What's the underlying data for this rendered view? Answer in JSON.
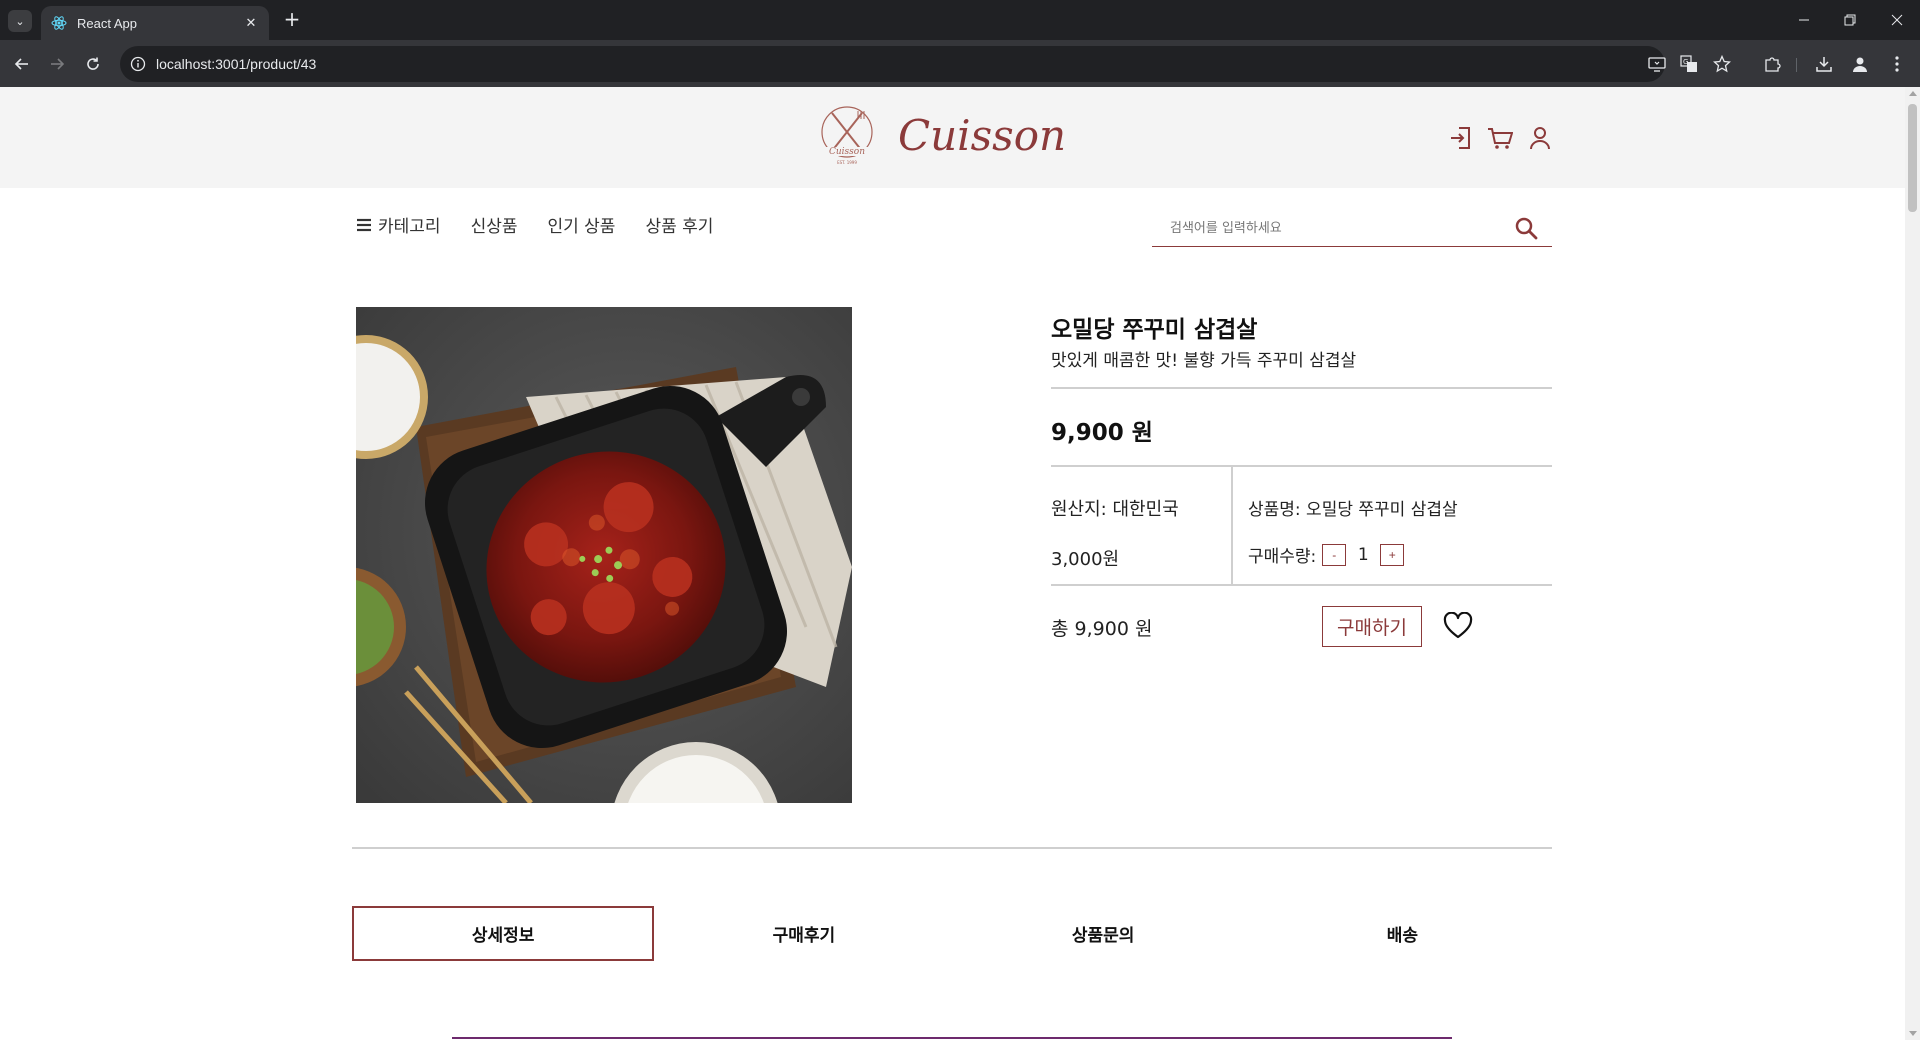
{
  "browser": {
    "tab_title": "React App",
    "url": "localhost:3001/product/43",
    "new_tab_symbol": "+",
    "close_symbol": "✕"
  },
  "site": {
    "brand_name": "Cuisson",
    "brand_color": "#8b3a3a",
    "header_icons": [
      "login-icon",
      "cart-icon",
      "user-icon"
    ]
  },
  "nav": {
    "items": [
      "카테고리",
      "신상품",
      "인기 상품",
      "상품 후기"
    ],
    "search_placeholder": "검색어를 입력하세요"
  },
  "product": {
    "name": "오밀당 쭈꾸미 삼겹살",
    "description": "맛있게 매콤한 맛! 불향 가득 주꾸미 삼겹살",
    "price": "9,900 원",
    "origin": "원산지: 대한민국",
    "shipping_fee": "3,000원",
    "product_name_label": "상품명: 오밀당 쭈꾸미 삼겹살",
    "quantity_label": "구매수량:",
    "quantity": "1",
    "minus": "-",
    "plus": "+",
    "total": "총 9,900 원",
    "buy_label": "구매하기"
  },
  "tabs": [
    "상세정보",
    "구매후기",
    "상품문의",
    "배송"
  ],
  "active_tab": "상세정보"
}
